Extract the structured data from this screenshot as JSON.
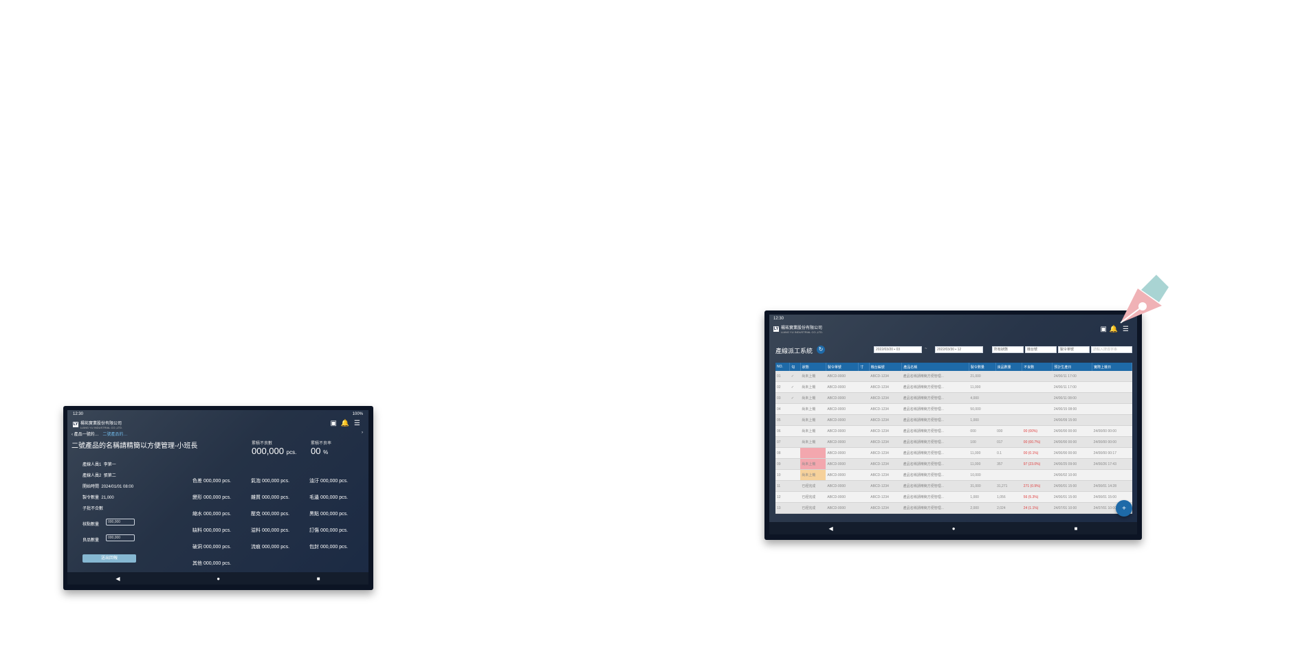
{
  "tablet1": {
    "time": "12:30",
    "battery": "100%",
    "company": "楊祐實業股份有限公司",
    "company_en": "LIANG YU INDUSTRIAL CO.,LTD.",
    "breadcrumb_1": "產品一號的…",
    "breadcrumb_2": "二號產品的…",
    "title": "二號產品的名稱請精簡以方便管理-小班長",
    "defect_count_label": "累積不良數",
    "defect_count": "000,000",
    "defect_count_unit": "pcs.",
    "defect_rate_label": "累積不良率",
    "defect_rate": "00",
    "defect_rate_unit": "%",
    "info": [
      {
        "label": "產線人員1",
        "value": "李第一"
      },
      {
        "label": "產線人員2",
        "value": "張第二"
      },
      {
        "label": "開始時間",
        "value": "2024/01/01 08:00"
      },
      {
        "label": "製令數量",
        "value": "21,000"
      },
      {
        "label": "子批不合數",
        "value": ""
      }
    ],
    "count_label": "核點數量",
    "count_placeholder": "000,000",
    "good_label": "良品數量",
    "good_placeholder": "000,000",
    "submit": "送出回報",
    "defects": [
      [
        "色差 000,000 pcs.",
        "氣泡 000,000 pcs.",
        "油汙 000,000 pcs."
      ],
      [
        "變形 000,000 pcs.",
        "雜質 000,000 pcs.",
        "毛邊 000,000 pcs."
      ],
      [
        "縮水 000,000 pcs.",
        "壓克 000,000 pcs.",
        "黑點 000,000 pcs."
      ],
      [
        "缺料 000,000 pcs.",
        "溢料 000,000 pcs.",
        "訂傷 000,000 pcs."
      ],
      [
        "破洞 000,000 pcs.",
        "流痕 000,000 pcs.",
        "包封 000,000 pcs."
      ],
      [
        "其他 000,000 pcs.",
        "",
        ""
      ]
    ]
  },
  "tablet2": {
    "time": "12:30",
    "company": "楊祐實業股份有限公司",
    "company_en": "LIANG YU INDUSTRIAL CO.,LTD.",
    "title": "產線派工系統",
    "date_from": "2022/03/20",
    "date_from_day": "03",
    "date_to": "2022/03/30",
    "date_to_day": "12",
    "filter_status": "所有狀態",
    "filter_machine": "機台號",
    "filter_order": "製令單號",
    "search_placeholder": "請輸入搜尋字串",
    "columns": [
      "NO.",
      "勾",
      "狀態",
      "製令單號",
      "寸",
      "機台編號",
      "產品名稱",
      "製令數量",
      "良品數量",
      "不良數",
      "預計生產日",
      "實際上機日"
    ],
    "rows": [
      [
        "01",
        "✓",
        "尚未上機",
        "ABCD-0000",
        "",
        "ABCD-1234",
        "產品名稱請精簡方便管理...",
        "21,000",
        "",
        "",
        "24/00/11 17:00",
        ""
      ],
      [
        "02",
        "✓",
        "尚未上機",
        "ABCD-0000",
        "",
        "ABCD-1234",
        "產品名稱請精簡方便管理...",
        "11,000",
        "",
        "",
        "24/00/11 17:00",
        ""
      ],
      [
        "03",
        "✓",
        "尚未上機",
        "ABCD-0000",
        "",
        "ABCD-1234",
        "產品名稱請精簡方便管理...",
        "4,000",
        "",
        "",
        "24/00/11 08:00",
        ""
      ],
      [
        "04",
        "",
        "尚未上機",
        "ABCD-0000",
        "",
        "ABCD-1234",
        "產品名稱請精簡方便管理...",
        "50,000",
        "",
        "",
        "24/00/15 08:00",
        ""
      ],
      [
        "05",
        "",
        "尚未上機",
        "ABCD-0000",
        "",
        "ABCD-1234",
        "產品名稱請精簡方便管理...",
        "1,000",
        "",
        "",
        "24/00/09 15:00",
        ""
      ],
      [
        "06",
        "",
        "尚未上機",
        "ABCD-0000",
        "",
        "ABCD-1234",
        "產品名稱請精簡方便管理...",
        "000",
        "000",
        "00 (00%)",
        "24/00/00 00:00",
        "24/00/00 00:00"
      ],
      [
        "07",
        "",
        "尚未上機",
        "ABCD-0000",
        "",
        "ABCD-1234",
        "產品名稱請精簡方便管理...",
        "100",
        "017",
        "00 (00.7%)",
        "24/00/00 00:00",
        "24/00/00 00:00"
      ],
      [
        "08",
        "",
        "",
        "ABCD-0000",
        "",
        "ABCD-1234",
        "產品名稱請精簡方便管理...",
        "11,000",
        "0.1",
        "00 (0.1%)",
        "24/00/00 00:00",
        "24/00/00 00:17"
      ],
      [
        "09",
        "",
        "尚未上機",
        "ABCD-0000",
        "",
        "ABCD-1234",
        "產品名稱請精簡方便管理...",
        "11,000",
        "357",
        "97 (23.0%)",
        "24/00/25 09:00",
        "24/00/26 17:43"
      ],
      [
        "10",
        "",
        "尚未上機",
        "ABCD-0000",
        "",
        "ABCD-1234",
        "產品名稱請精簡方便管理...",
        "10,000",
        "",
        "",
        "24/00/02 10:00",
        ""
      ],
      [
        "11",
        "",
        "已經完成",
        "ABCD-0000",
        "",
        "ABCD-1234",
        "產品名稱請精簡方便管理...",
        "31,000",
        "31,271",
        "271 (0.9%)",
        "24/00/01 15:00",
        "24/00/01 14:28"
      ],
      [
        "12",
        "",
        "已經完成",
        "ABCD-0000",
        "",
        "ABCD-1234",
        "產品名稱請精簡方便管理...",
        "1,000",
        "1,056",
        "56 (5.3%)",
        "24/00/01 15:00",
        "24/00/01 15:00"
      ],
      [
        "13",
        "",
        "已經完成",
        "ABCD-0000",
        "",
        "ABCD-1234",
        "產品名稱請精簡方便管理...",
        "2,000",
        "2,024",
        "24 (1.1%)",
        "24/07/01 10:00",
        "24/07/01 10:00"
      ]
    ],
    "fab_label": "+"
  },
  "colors": {
    "header": "#1e6aa8",
    "danger_row": "#f3a7ae",
    "warn_row": "#f6d19b",
    "defect_text": "#e04040"
  }
}
